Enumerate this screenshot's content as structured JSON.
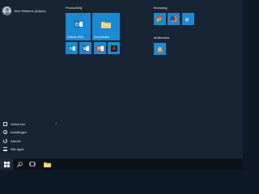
{
  "user": {
    "name": "John Ribbens (Admin)"
  },
  "nav": [
    {
      "label": "Verkenner",
      "icon": "file-explorer-icon",
      "has_chevron": true
    },
    {
      "label": "Instellingen",
      "icon": "settings-gear-icon",
      "has_chevron": false
    },
    {
      "label": "Aan/uit",
      "icon": "power-icon",
      "has_chevron": false
    },
    {
      "label": "Alle apps",
      "icon": "all-apps-icon",
      "has_chevron": false
    }
  ],
  "groups": {
    "productivity": {
      "title": "Productivity",
      "tiles": [
        {
          "label": "Outlook 2016",
          "icon": "outlook-icon"
        },
        {
          "label": "Documenten",
          "icon": "folder-icon"
        },
        {
          "label": "",
          "icon": "outlook-small-icon"
        },
        {
          "label": "",
          "icon": "word-icon"
        },
        {
          "label": "",
          "icon": "powerpoint-icon"
        },
        {
          "label": "",
          "icon": "acrobat-icon"
        }
      ]
    },
    "browsing": {
      "title": "Browsing",
      "tiles": [
        {
          "label": "",
          "icon": "chrome-icon"
        },
        {
          "label": "",
          "icon": "firefox-icon"
        },
        {
          "label": "",
          "icon": "edge-icon"
        }
      ]
    },
    "multimedia": {
      "title": "Multimedia",
      "tiles": [
        {
          "label": "",
          "icon": "vlc-icon"
        }
      ]
    }
  },
  "taskbar": {
    "items": [
      "windows-start-icon",
      "search-icon",
      "task-view-icon",
      "file-explorer-icon"
    ]
  },
  "colors": {
    "accent": "#1a8ad4",
    "menu_bg": "#172433",
    "taskbar_bg": "#0b1219"
  }
}
